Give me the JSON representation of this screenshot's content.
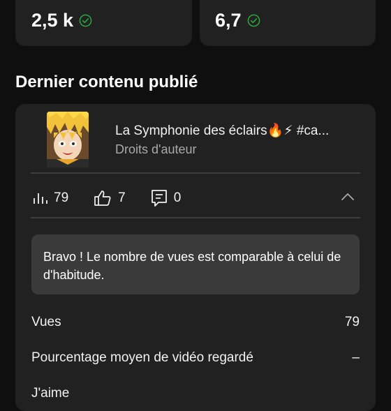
{
  "top_stats": [
    {
      "value": "2,5 k",
      "status_icon": "check-circle-icon"
    },
    {
      "value": "6,7",
      "status_icon": "check-circle-icon"
    }
  ],
  "section": {
    "title": "Dernier contenu publié"
  },
  "video": {
    "title": "La Symphonie des éclairs🔥⚡ #ca...",
    "subtitle": "Droits d'auteur",
    "thumbnail_icon": "anime-character-thumbnail"
  },
  "metrics": {
    "views": "79",
    "likes": "7",
    "comments": "0"
  },
  "notice": {
    "text": "Bravo ! Le nombre de vues est comparable à celui de d'habitude."
  },
  "rows": [
    {
      "label": "Vues",
      "value": "79"
    },
    {
      "label": "Pourcentage moyen de vidéo regardé",
      "value": "–"
    },
    {
      "label": "J'aime",
      "value": ""
    }
  ],
  "colors": {
    "background": "#0f0f0f",
    "card": "#212121",
    "notice": "#3a3a3a",
    "check_green": "#2ba640",
    "secondary_text": "#aaaaaa"
  }
}
